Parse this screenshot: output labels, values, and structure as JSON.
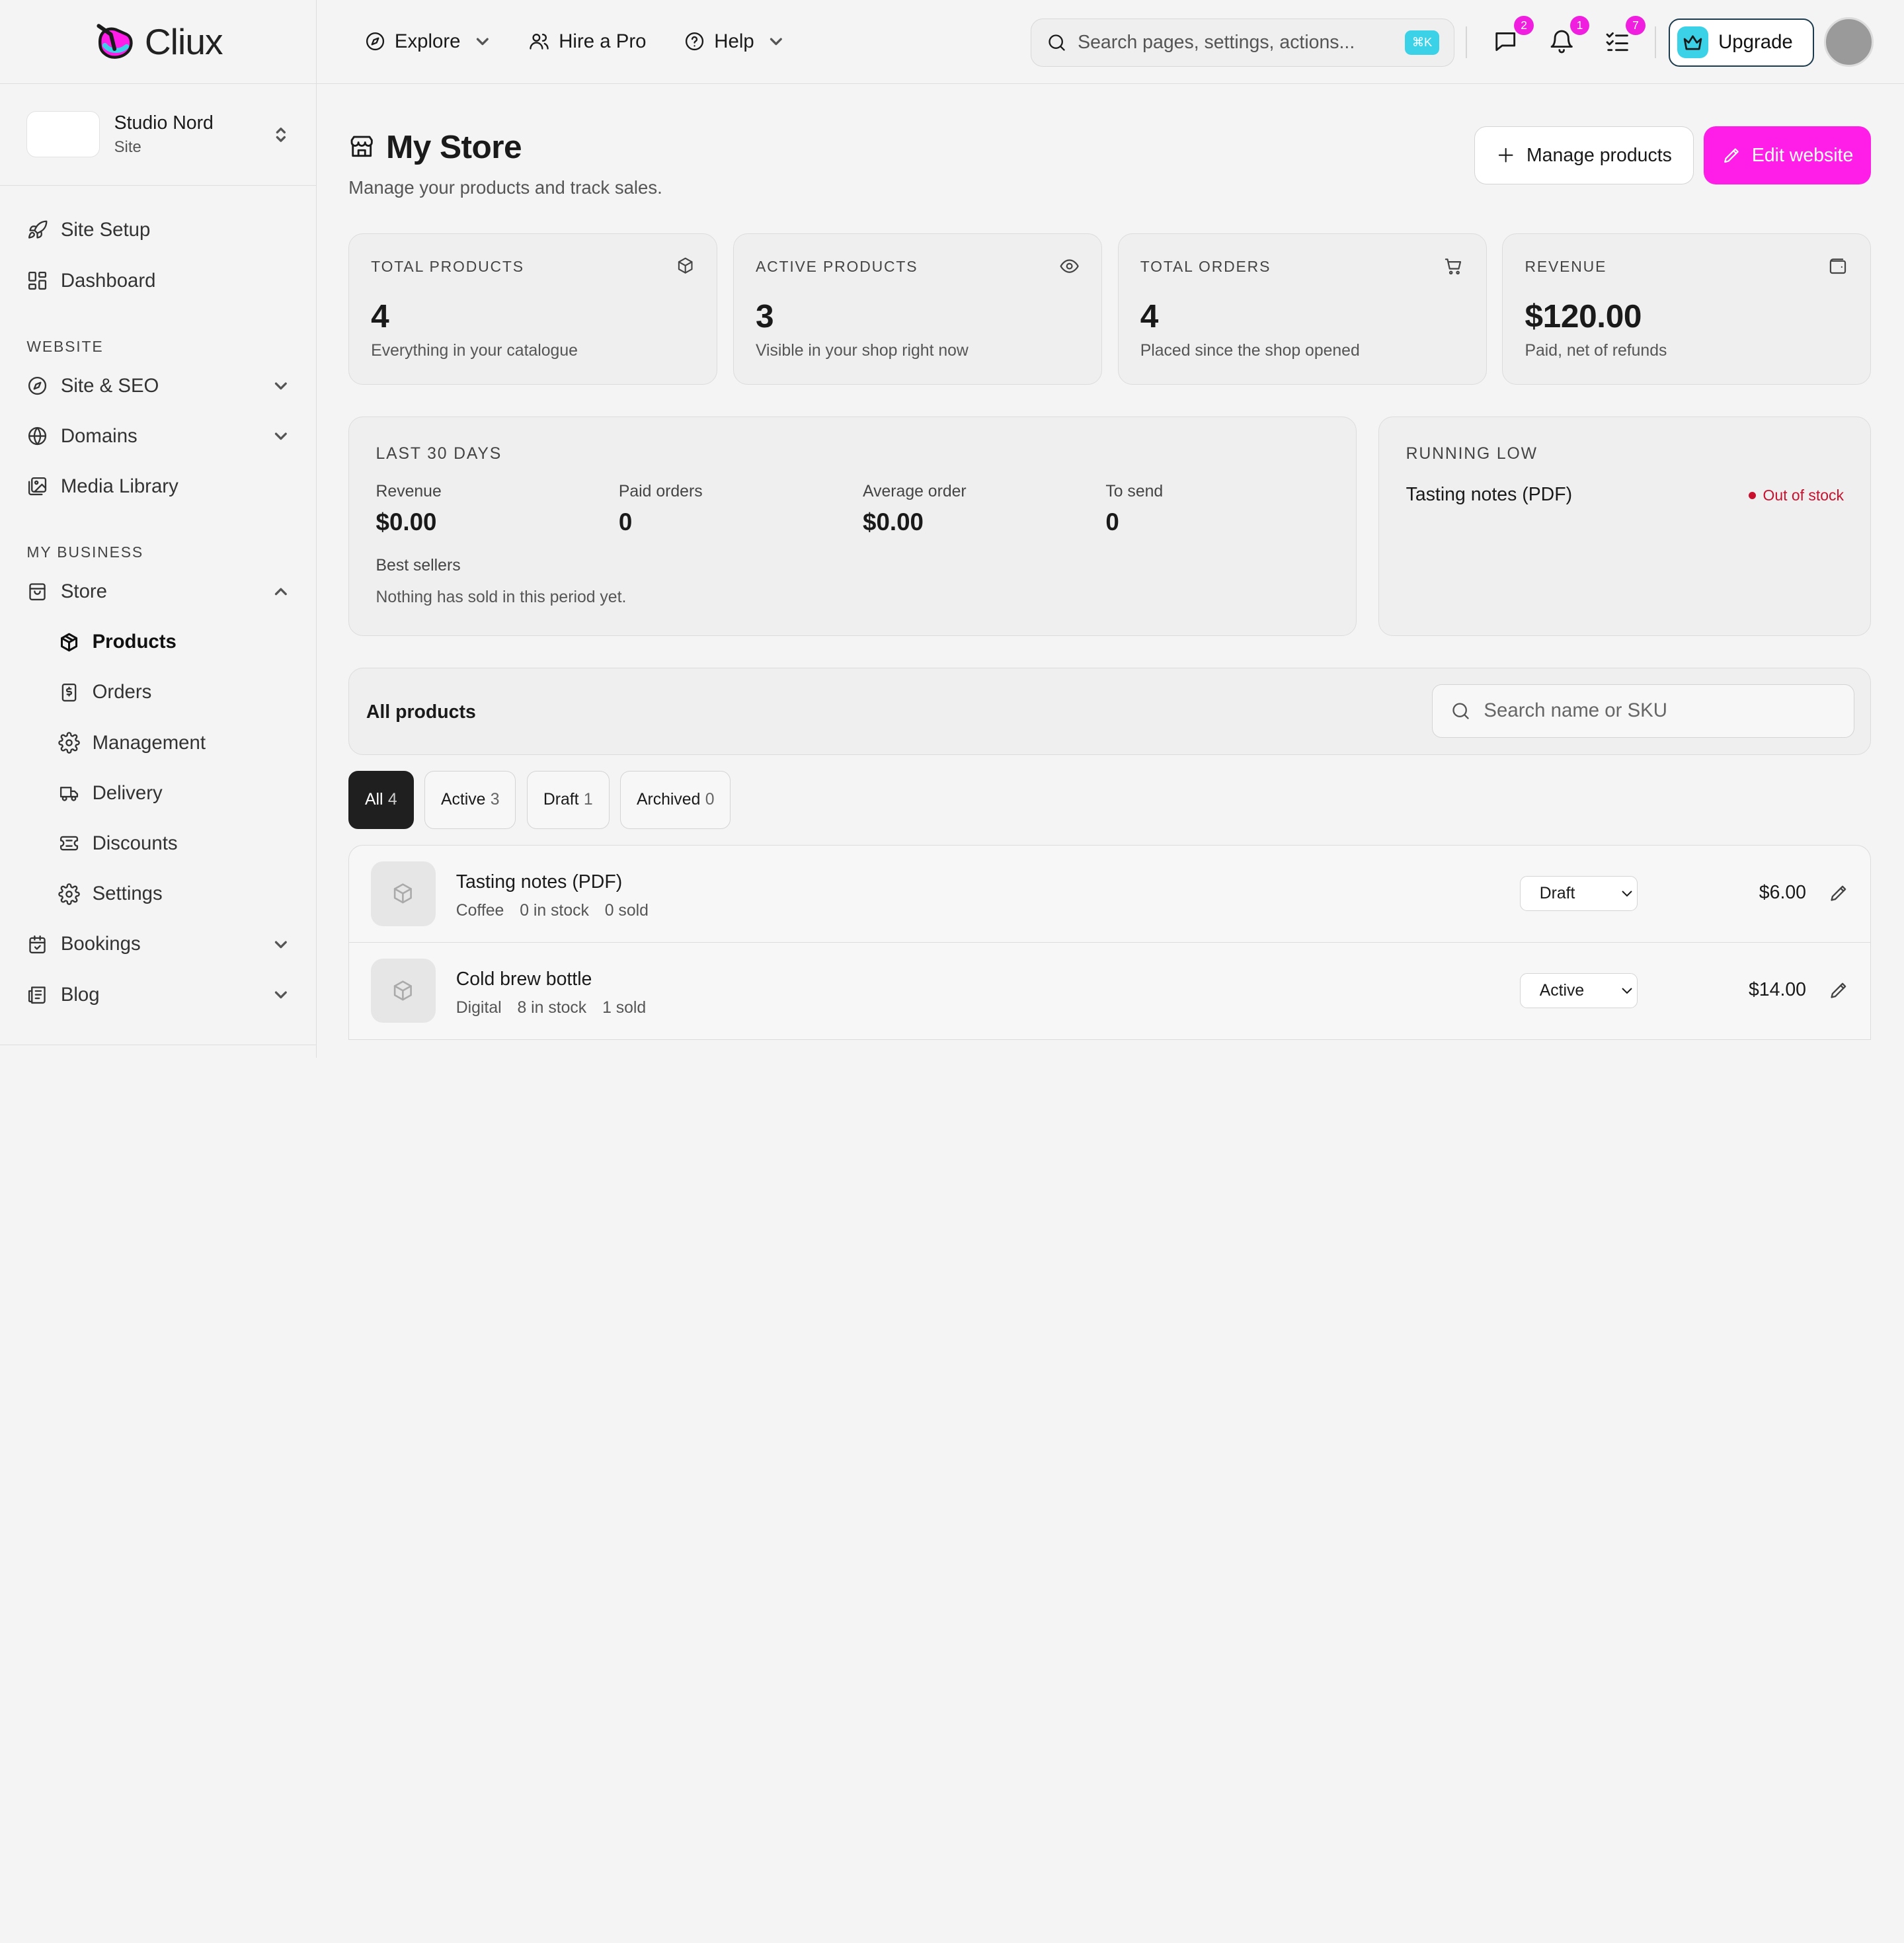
{
  "brand": {
    "name": "Cliux"
  },
  "site": {
    "name": "Studio Nord",
    "type": "Site"
  },
  "sidebar": {
    "top_items": [
      {
        "label": "Site Setup",
        "icon": "rocket-icon"
      },
      {
        "label": "Dashboard",
        "icon": "dashboard-icon"
      }
    ],
    "sections": [
      {
        "title": "WEBSITE",
        "items": [
          {
            "label": "Site & SEO",
            "icon": "compass-icon",
            "expandable": true
          },
          {
            "label": "Domains",
            "icon": "globe-icon",
            "expandable": true
          },
          {
            "label": "Media Library",
            "icon": "image-icon",
            "expandable": false
          }
        ]
      },
      {
        "title": "MY BUSINESS",
        "items": [
          {
            "label": "Store",
            "icon": "bag-icon",
            "expanded": true
          },
          {
            "label": "Products",
            "icon": "box-icon",
            "active": true
          },
          {
            "label": "Orders",
            "icon": "receipt-icon"
          },
          {
            "label": "Management",
            "icon": "gear-icon"
          },
          {
            "label": "Delivery",
            "icon": "truck-icon"
          },
          {
            "label": "Discounts",
            "icon": "ticket-icon"
          },
          {
            "label": "Settings",
            "icon": "gear-icon"
          },
          {
            "label": "Bookings",
            "icon": "calendar-icon",
            "expandable": true
          },
          {
            "label": "Blog",
            "icon": "newspaper-icon",
            "expandable": true
          }
        ]
      }
    ]
  },
  "topbar": {
    "explore": "Explore",
    "hire": "Hire a Pro",
    "help": "Help",
    "search_placeholder": "Search pages, settings, actions...",
    "search_shortcut": "⌘K",
    "badges": {
      "messages": "2",
      "notifications": "1",
      "tasks": "7"
    },
    "upgrade": "Upgrade"
  },
  "page": {
    "title": "My Store",
    "subtitle": "Manage your products and track sales.",
    "manage_button": "Manage products",
    "edit_button": "Edit website"
  },
  "stats": [
    {
      "label": "TOTAL PRODUCTS",
      "value": "4",
      "desc": "Everything in your catalogue",
      "icon": "box-icon"
    },
    {
      "label": "ACTIVE PRODUCTS",
      "value": "3",
      "desc": "Visible in your shop right now",
      "icon": "eye-icon"
    },
    {
      "label": "TOTAL ORDERS",
      "value": "4",
      "desc": "Placed since the shop opened",
      "icon": "cart-icon"
    },
    {
      "label": "REVENUE",
      "value": "$120.00",
      "desc": "Paid, net of refunds",
      "icon": "wallet-icon"
    }
  ],
  "last30": {
    "title": "LAST 30 DAYS",
    "metrics": [
      {
        "label": "Revenue",
        "value": "$0.00"
      },
      {
        "label": "Paid orders",
        "value": "0"
      },
      {
        "label": "Average order",
        "value": "$0.00"
      },
      {
        "label": "To send",
        "value": "0"
      }
    ],
    "best_label": "Best sellers",
    "best_empty": "Nothing has sold in this period yet."
  },
  "running_low": {
    "title": "RUNNING LOW",
    "item": "Tasting notes (PDF)",
    "status": "Out of stock",
    "status_color": "#c8102e"
  },
  "products_list": {
    "title": "All products",
    "search_placeholder": "Search name or SKU",
    "filters": [
      {
        "label": "All",
        "count": "4",
        "active": true
      },
      {
        "label": "Active",
        "count": "3"
      },
      {
        "label": "Draft",
        "count": "1"
      },
      {
        "label": "Archived",
        "count": "0"
      }
    ],
    "items": [
      {
        "name": "Tasting notes (PDF)",
        "category": "Coffee",
        "stock": "0 in stock",
        "sold": "0 sold",
        "status": "Draft",
        "price": "$6.00"
      },
      {
        "name": "Cold brew bottle",
        "category": "Digital",
        "stock": "8 in stock",
        "sold": "1 sold",
        "status": "Active",
        "price": "$14.00"
      }
    ],
    "status_options": [
      "Draft",
      "Active",
      "Archived"
    ]
  },
  "colors": {
    "accent": "#ff1ee8",
    "badge": "#f01fe0",
    "cyan": "#3bd2e8",
    "danger": "#c8102e"
  }
}
